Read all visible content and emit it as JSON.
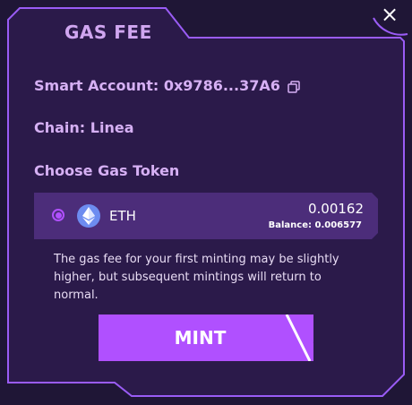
{
  "modal": {
    "title": "GAS FEE",
    "close_label": "×"
  },
  "info": {
    "smart_account": "Smart Account: 0x9786...37A6",
    "chain": "Chain: Linea",
    "choose_heading": "Choose Gas Token"
  },
  "token": {
    "symbol": "ETH",
    "amount": "0.00162",
    "balance": "Balance: 0.006577",
    "selected": true
  },
  "notice": "The gas fee for your first minting may be slightly higher, but subsequent mintings will return to normal.",
  "mint_button": {
    "label": "MINT"
  },
  "icons": {
    "close": "close-icon",
    "copy": "copy-icon",
    "token": "ethereum-icon",
    "radio": "radio-selected-icon"
  },
  "colors": {
    "background": "#1f1636",
    "panel": "#2b1a4a",
    "border": "#9a5cf5",
    "accent": "#b050ff",
    "title": "#d0a6f0",
    "label": "#d6b0f4",
    "token_row": "#4c2d7a"
  }
}
